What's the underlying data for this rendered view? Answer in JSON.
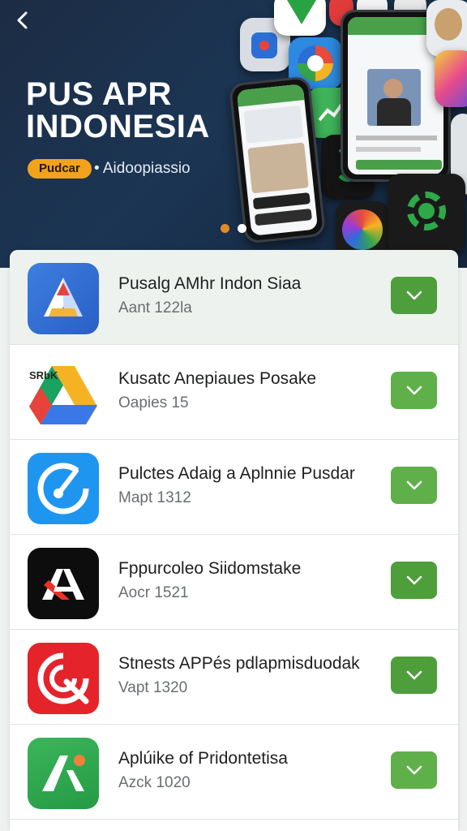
{
  "hero": {
    "title_line1": "PUS APR",
    "title_line2": "INDONESIA",
    "tag": "Pudcar",
    "subtitle": "• Aidoopiassio",
    "carousel_active_index": 0,
    "carousel_count": 2
  },
  "colors": {
    "hero_bg": "#1b3553",
    "tag_bg": "#f2a21c",
    "download_green": "#5fb04a",
    "active_dot": "#e58a2a"
  },
  "apps": [
    {
      "name": "Pusalg AMhr Indon Siaa",
      "meta": "Aant 122la",
      "icon": "blue-triangle-icon"
    },
    {
      "name": "Kusatc Anepiaues Posake",
      "meta": "Oapies 15",
      "icon": "drive-triangle-icon",
      "icon_text": "SRbK"
    },
    {
      "name": "Pulctes Adaig a Aplnnie Pusdar",
      "meta": "Mapt 1312",
      "icon": "blue-circle-icon"
    },
    {
      "name": "Fppurcoleo Siidomstake",
      "meta": "Aocr 1521",
      "icon": "black-a-icon"
    },
    {
      "name": "Stnests APPés pdlapmisduodak",
      "meta": "Vapt 1320",
      "icon": "red-target-icon"
    },
    {
      "name": "Aplúike of Pridontetisa",
      "meta": "Azck 1020",
      "icon": "green-a-icon"
    }
  ]
}
